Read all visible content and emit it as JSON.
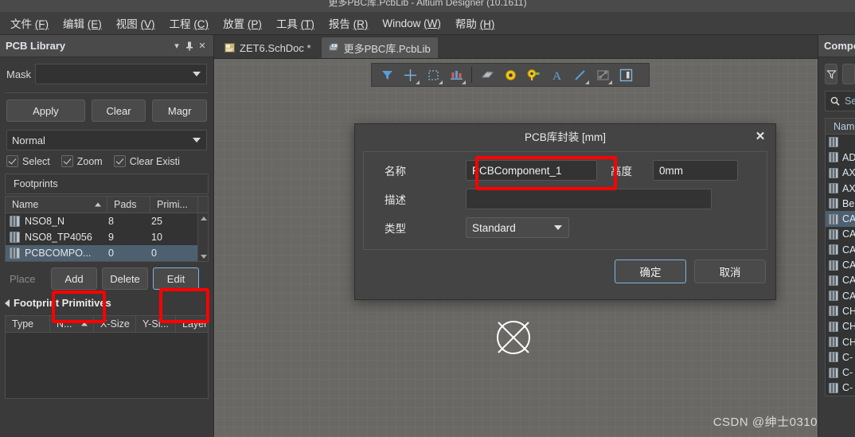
{
  "window": {
    "title": "更多PBC库.PcbLib - Altium Designer (10.1611)"
  },
  "menubar": {
    "items": [
      {
        "label": "文件",
        "accel": "(F)"
      },
      {
        "label": "编辑",
        "accel": "(E)"
      },
      {
        "label": "视图",
        "accel": "(V)"
      },
      {
        "label": "工程",
        "accel": "(C)"
      },
      {
        "label": "放置",
        "accel": "(P)"
      },
      {
        "label": "工具",
        "accel": "(T)"
      },
      {
        "label": "报告",
        "accel": "(R)"
      },
      {
        "label": "Window",
        "accel": "(W)"
      },
      {
        "label": "帮助",
        "accel": "(H)"
      }
    ]
  },
  "left_panel": {
    "title": "PCB Library",
    "mask": {
      "label": "Mask",
      "value": "",
      "placeholder": ""
    },
    "buttons": {
      "apply": "Apply",
      "clear": "Clear",
      "magnify": "Magr"
    },
    "mode_select": {
      "value": "Normal"
    },
    "checkboxes": [
      {
        "label": "Select",
        "checked": true
      },
      {
        "label": "Zoom",
        "checked": true
      },
      {
        "label": "Clear Existi",
        "checked": true
      }
    ],
    "footprints": {
      "group_title": "Footprints",
      "columns": [
        "Name",
        "Pads",
        "Primi..."
      ],
      "sort_column": "Name",
      "sort_direction": "asc",
      "rows": [
        {
          "name": "NSO8_N",
          "pads": "8",
          "primitives": "25",
          "selected": false
        },
        {
          "name": "NSO8_TP4056",
          "pads": "9",
          "primitives": "10",
          "selected": false
        },
        {
          "name": "PCBCOMPO...",
          "pads": "0",
          "primitives": "0",
          "selected": true
        }
      ]
    },
    "action_buttons": [
      {
        "label": "Place",
        "disabled": true,
        "highlighted": false,
        "focused": false
      },
      {
        "label": "Add",
        "disabled": false,
        "highlighted": true,
        "focused": false
      },
      {
        "label": "Delete",
        "disabled": false,
        "highlighted": false,
        "focused": false
      },
      {
        "label": "Edit",
        "disabled": false,
        "highlighted": true,
        "focused": true
      }
    ],
    "primitives": {
      "title": "Footprint Primitives",
      "columns": [
        "Type",
        "N...",
        "X-Size",
        "Y-Si...",
        "Layer"
      ],
      "sort_column": "N...",
      "rows": []
    }
  },
  "tabs": [
    {
      "label": "ZET6.SchDoc *",
      "icon": "schematic-doc-icon",
      "active": false
    },
    {
      "label": "更多PBC库.PcbLib",
      "icon": "pcblib-doc-icon",
      "active": true
    }
  ],
  "canvas_toolbar": {
    "tools": [
      {
        "name": "filter-icon",
        "has_submenu": false
      },
      {
        "name": "crosshair-place-icon",
        "has_submenu": true
      },
      {
        "name": "marquee-select-icon",
        "has_submenu": true
      },
      {
        "name": "align-icon",
        "has_submenu": true
      },
      {
        "name": "component-icon",
        "has_submenu": false
      },
      {
        "name": "via-icon",
        "has_submenu": false
      },
      {
        "name": "pad-icon",
        "has_submenu": false
      },
      {
        "name": "text-icon",
        "has_submenu": false
      },
      {
        "name": "line-icon",
        "has_submenu": true
      },
      {
        "name": "dimension-icon",
        "has_submenu": true
      },
      {
        "name": "fill-region-icon",
        "has_submenu": false
      }
    ]
  },
  "dialog": {
    "title": "PCB库封装 [mm]",
    "close_label": "✕",
    "fields": {
      "name_label": "名称",
      "name_value": "PCBComponent_1",
      "height_label": "高度",
      "height_value": "0mm",
      "desc_label": "描述",
      "desc_value": "",
      "type_label": "类型",
      "type_value": "Standard"
    },
    "ok_label": "确定",
    "cancel_label": "取消"
  },
  "right_panel": {
    "title": "Compo",
    "filter_icon": "funnel-icon",
    "search_placeholder": "Se",
    "column_header": "Name",
    "rows": [
      {
        "name": "",
        "selected": false
      },
      {
        "name": "AD",
        "selected": false
      },
      {
        "name": "AX",
        "selected": false
      },
      {
        "name": "AX",
        "selected": false
      },
      {
        "name": "Be",
        "selected": false
      },
      {
        "name": "CA",
        "selected": true
      },
      {
        "name": "CA",
        "selected": false
      },
      {
        "name": "CA",
        "selected": false
      },
      {
        "name": "CA",
        "selected": false
      },
      {
        "name": "CA",
        "selected": false
      },
      {
        "name": "CA",
        "selected": false
      },
      {
        "name": "CH",
        "selected": false
      },
      {
        "name": "CH",
        "selected": false
      },
      {
        "name": "CH",
        "selected": false
      },
      {
        "name": "C-",
        "selected": false
      },
      {
        "name": "C-",
        "selected": false
      },
      {
        "name": "C-",
        "selected": false
      }
    ]
  },
  "watermark": "CSDN @绅士0310",
  "colors": {
    "accent_red": "#ff0000",
    "panel_bg": "#3a3a3a",
    "canvas_bg": "#6a6865",
    "selection_blue": "#4d6070",
    "focus_border": "#7fb4de"
  }
}
